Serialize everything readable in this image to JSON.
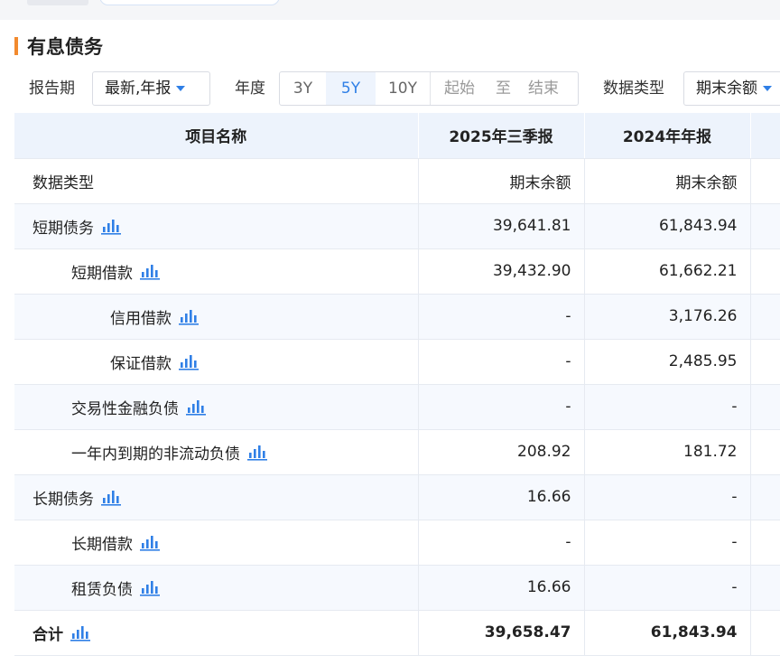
{
  "section": {
    "title": "有息债务"
  },
  "filters": {
    "report_period_label": "报告期",
    "report_period_value": "最新,年报",
    "year_label": "年度",
    "year_options": [
      "3Y",
      "5Y",
      "10Y"
    ],
    "year_selected": "5Y",
    "start_placeholder": "起始",
    "to_text": "至",
    "end_placeholder": "结束",
    "data_type_label": "数据类型",
    "data_type_value": "期末余额"
  },
  "table": {
    "headers": [
      "项目名称",
      "2025年三季报",
      "2024年年报",
      ""
    ],
    "rows": [
      {
        "name": "数据类型",
        "indent": 0,
        "icon": false,
        "values": [
          "期末余额",
          "期末余额"
        ]
      },
      {
        "name": "短期债务",
        "indent": 0,
        "icon": true,
        "values": [
          "39,641.81",
          "61,843.94"
        ]
      },
      {
        "name": "短期借款",
        "indent": 1,
        "icon": true,
        "values": [
          "39,432.90",
          "61,662.21"
        ]
      },
      {
        "name": "信用借款",
        "indent": 2,
        "icon": true,
        "values": [
          "-",
          "3,176.26"
        ]
      },
      {
        "name": "保证借款",
        "indent": 2,
        "icon": true,
        "values": [
          "-",
          "2,485.95"
        ]
      },
      {
        "name": "交易性金融负债",
        "indent": 1,
        "icon": true,
        "values": [
          "-",
          "-"
        ]
      },
      {
        "name": "一年内到期的非流动负债",
        "indent": 1,
        "icon": true,
        "values": [
          "208.92",
          "181.72"
        ]
      },
      {
        "name": "长期债务",
        "indent": 0,
        "icon": true,
        "values": [
          "16.66",
          "-"
        ]
      },
      {
        "name": "长期借款",
        "indent": 1,
        "icon": true,
        "values": [
          "-",
          "-"
        ]
      },
      {
        "name": "租赁负债",
        "indent": 1,
        "icon": true,
        "values": [
          "16.66",
          "-"
        ]
      },
      {
        "name": "合计",
        "indent": 0,
        "icon": true,
        "values": [
          "39,658.47",
          "61,843.94"
        ],
        "total": true
      }
    ]
  },
  "colors": {
    "accent": "#2f7fe6",
    "title_bar": "#f28a2e",
    "header_bg": "#edf3fc",
    "alt_row_bg": "#f6f9fe"
  },
  "icons": {
    "row_chart": "bar-chart-icon",
    "dropdown": "caret-down-icon"
  }
}
